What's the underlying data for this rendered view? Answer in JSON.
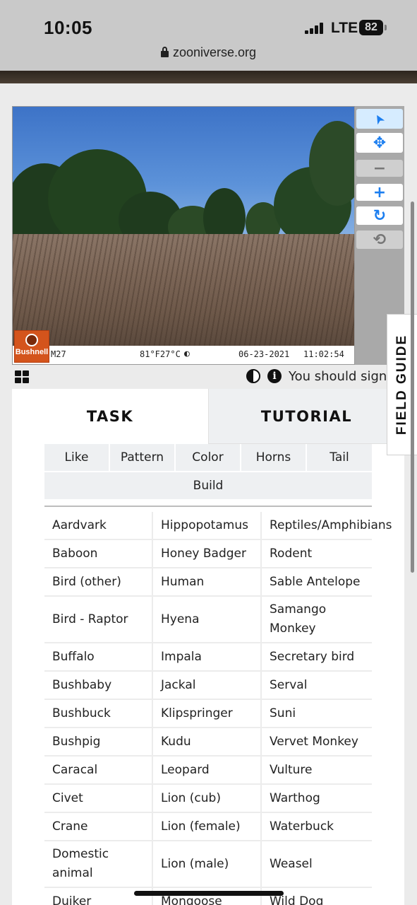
{
  "status": {
    "time": "10:05",
    "network": "LTE",
    "battery": "82",
    "url": "zooniverse.org"
  },
  "subject": {
    "camera_brand": "Bushnell",
    "cam_id": "M27",
    "temperature": "81°F27°C",
    "date": "06-23-2021",
    "clock": "11:02:54"
  },
  "toolbar": {
    "tools": [
      {
        "name": "annotate",
        "icon": "pointer-icon",
        "glyph": "➤"
      },
      {
        "name": "move",
        "icon": "move-icon",
        "glyph": "✥"
      },
      {
        "name": "zoom-out",
        "icon": "minus-icon",
        "glyph": "−"
      },
      {
        "name": "zoom-in",
        "icon": "plus-icon",
        "glyph": "+"
      },
      {
        "name": "rotate",
        "icon": "rotate-icon",
        "glyph": "↻"
      },
      {
        "name": "reset",
        "icon": "reset-icon",
        "glyph": "⟲"
      }
    ]
  },
  "metabar": {
    "signin_text": "You should sign"
  },
  "field_guide": "FIELD GUIDE",
  "tabs": {
    "task": "TASK",
    "tutorial": "TUTORIAL"
  },
  "filters": [
    "Like",
    "Pattern",
    "Color",
    "Horns",
    "Tail",
    "Build"
  ],
  "choices": [
    [
      "Aardvark",
      "Hippopotamus",
      "Reptiles/Amphibians"
    ],
    [
      "Baboon",
      "Honey Badger",
      "Rodent"
    ],
    [
      "Bird (other)",
      "Human",
      "Sable Antelope"
    ],
    [
      "Bird - Raptor",
      "Hyena",
      "Samango Monkey"
    ],
    [
      "Buffalo",
      "Impala",
      "Secretary bird"
    ],
    [
      "Bushbaby",
      "Jackal",
      "Serval"
    ],
    [
      "Bushbuck",
      "Klipspringer",
      "Suni"
    ],
    [
      "Bushpig",
      "Kudu",
      "Vervet Monkey"
    ],
    [
      "Caracal",
      "Leopard",
      "Vulture"
    ],
    [
      "Civet",
      "Lion (cub)",
      "Warthog"
    ],
    [
      "Crane",
      "Lion (female)",
      "Waterbuck"
    ],
    [
      "Domestic animal",
      "Lion (male)",
      "Weasel"
    ],
    [
      "Duiker",
      "Mongoose",
      "Wild Dog"
    ]
  ],
  "colors": {
    "accent_blue": "#1b7ef0",
    "tab_inactive": "#eef0f2",
    "bushnell_orange": "#d4541c"
  }
}
